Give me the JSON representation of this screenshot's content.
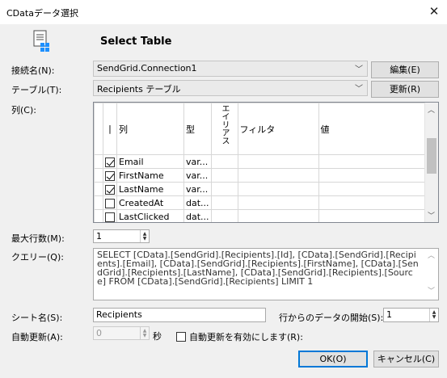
{
  "window": {
    "title": "CDataデータ選択",
    "close_glyph": "✕"
  },
  "header": {
    "title": "Select Table",
    "icon": "table-document-icon"
  },
  "connection": {
    "label": "接続名(N):",
    "value": "SendGrid.Connection1",
    "edit_button": "編集(E)"
  },
  "table": {
    "label": "テーブル(T):",
    "value": "Recipients テーブル",
    "refresh_button": "更新(R)"
  },
  "columns": {
    "label": "列(C):",
    "headers": {
      "select": "|",
      "column": "列",
      "type": "型",
      "alias": "エイリアス",
      "filter": "フィルタ",
      "value": "値"
    },
    "rows": [
      {
        "checked": true,
        "name": "Email",
        "type": "var..."
      },
      {
        "checked": true,
        "name": "FirstName",
        "type": "var..."
      },
      {
        "checked": true,
        "name": "LastName",
        "type": "var..."
      },
      {
        "checked": false,
        "name": "CreatedAt",
        "type": "dat..."
      },
      {
        "checked": false,
        "name": "LastClicked",
        "type": "dat..."
      }
    ]
  },
  "max_rows": {
    "label": "最大行数(M):",
    "value": "1"
  },
  "query": {
    "label": "クエリー(Q):",
    "value": "SELECT [CData].[SendGrid].[Recipients].[Id], [CData].[SendGrid].[Recipients].[Email], [CData].[SendGrid].[Recipients].[FirstName], [CData].[SendGrid].[Recipients].[LastName], [CData].[SendGrid].[Recipients].[Source] FROM [CData].[SendGrid].[Recipients] LIMIT 1"
  },
  "sheet": {
    "label": "シート名(S):",
    "value": "Recipients",
    "start_label": "行からのデータの開始(S):",
    "start_value": "1"
  },
  "auto_refresh": {
    "label": "自動更新(A):",
    "value": "0",
    "unit": "秒",
    "checkbox_label": "自動更新を有効にします(R):"
  },
  "footer": {
    "ok": "OK(O)",
    "cancel": "キャンセル(C)"
  },
  "colors": {
    "accent": "#0078d7",
    "window_bg": "#f0f0f0"
  }
}
